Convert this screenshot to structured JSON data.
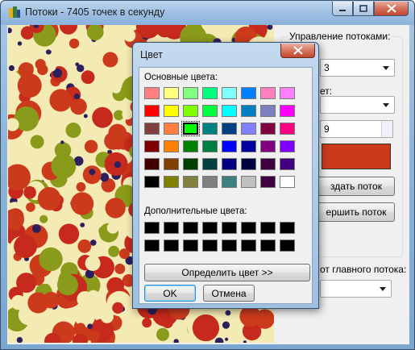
{
  "window": {
    "title": "Потоки - 7405 точек в секунду"
  },
  "panel": {
    "group_title": "Управление потоками:",
    "combo1_value": "3",
    "label2": "ет:",
    "combo2_value": "",
    "spin_value": "9",
    "color_hex": "#cc3a1c",
    "create_label": "здать поток",
    "finish_label": "ершить поток",
    "main_thread_label": "от главного потока:",
    "combo3_value": ""
  },
  "dialog": {
    "title": "Цвет",
    "basic_label": "Основные цвета:",
    "custom_label": "Дополнительные цвета:",
    "define_button": "Определить цвет >>",
    "ok_button": "OK",
    "cancel_button": "Отмена",
    "selected_index": 18,
    "basic_colors": [
      "#ff8080",
      "#ffff80",
      "#80ff80",
      "#00ff80",
      "#80ffff",
      "#0080ff",
      "#ff80c0",
      "#ff80ff",
      "#ff0000",
      "#ffff00",
      "#80ff00",
      "#00ff40",
      "#00ffff",
      "#0080c0",
      "#8080c0",
      "#ff00ff",
      "#804040",
      "#ff8040",
      "#00ff00",
      "#008080",
      "#004080",
      "#8080ff",
      "#800040",
      "#ff0080",
      "#800000",
      "#ff8000",
      "#008000",
      "#008040",
      "#0000ff",
      "#0000a0",
      "#800080",
      "#8000ff",
      "#400000",
      "#804000",
      "#004000",
      "#004040",
      "#000080",
      "#000040",
      "#400040",
      "#400080",
      "#000000",
      "#808000",
      "#808040",
      "#808080",
      "#408080",
      "#c0c0c0",
      "#400040",
      "#ffffff"
    ],
    "custom_colors": [
      "#000000",
      "#000000",
      "#000000",
      "#000000",
      "#000000",
      "#000000",
      "#000000",
      "#000000",
      "#000000",
      "#000000",
      "#000000",
      "#000000",
      "#000000",
      "#000000",
      "#000000",
      "#000000"
    ]
  },
  "canvas": {
    "palette": [
      "#cc3a1c",
      "#8a9a1a",
      "#f4eab4",
      "#2b1f5e",
      "#c62a1c"
    ],
    "background": "#f4eab4"
  }
}
